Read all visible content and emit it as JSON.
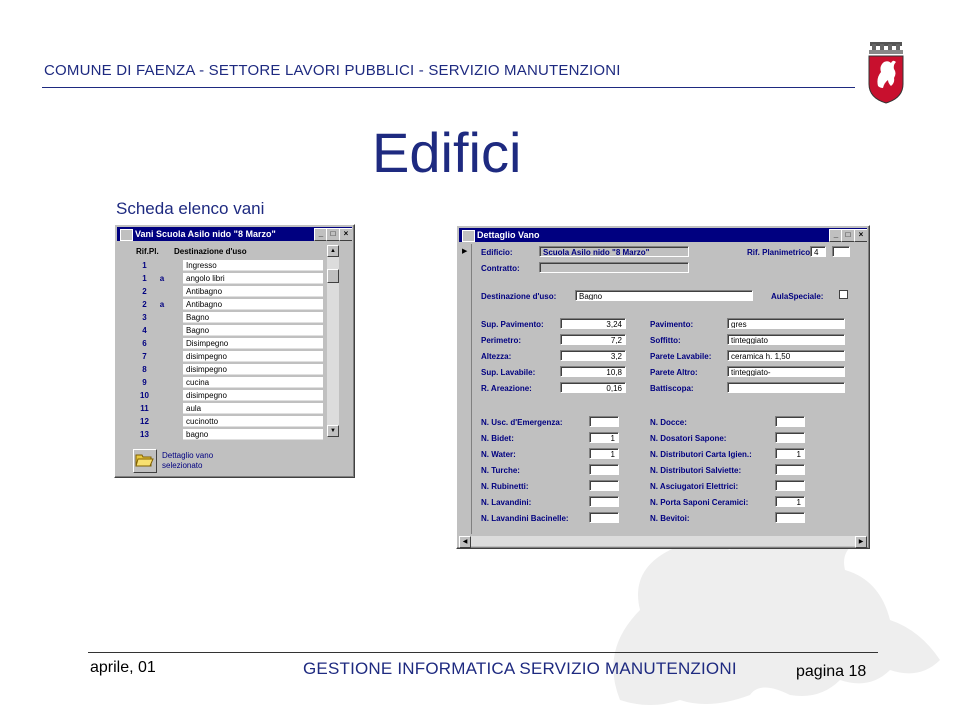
{
  "header": {
    "title": "COMUNE DI FAENZA - SETTORE LAVORI PUBBLICI - SERVIZIO MANUTENZIONI"
  },
  "slide": {
    "title": "Edifici",
    "subtitle": "Scheda elenco vani"
  },
  "list_window": {
    "title": "Vani Scuola Asilo nido \"8 Marzo\"",
    "col_rif": "Rif.Pl.",
    "col_dest": "Destinazione d'uso",
    "rows": [
      {
        "num": "1",
        "suf": "",
        "dest": "Ingresso"
      },
      {
        "num": "1",
        "suf": "a",
        "dest": "angolo libri"
      },
      {
        "num": "2",
        "suf": "",
        "dest": "Antibagno"
      },
      {
        "num": "2",
        "suf": "a",
        "dest": "Antibagno"
      },
      {
        "num": "3",
        "suf": "",
        "dest": "Bagno"
      },
      {
        "num": "4",
        "suf": "",
        "dest": "Bagno"
      },
      {
        "num": "6",
        "suf": "",
        "dest": "Disimpegno"
      },
      {
        "num": "7",
        "suf": "",
        "dest": "disimpegno"
      },
      {
        "num": "8",
        "suf": "",
        "dest": "disimpegno"
      },
      {
        "num": "9",
        "suf": "",
        "dest": "cucina"
      },
      {
        "num": "10",
        "suf": "",
        "dest": "disimpegno"
      },
      {
        "num": "11",
        "suf": "",
        "dest": "aula"
      },
      {
        "num": "12",
        "suf": "",
        "dest": "cucinotto"
      },
      {
        "num": "13",
        "suf": "",
        "dest": "bagno"
      }
    ],
    "detail_label": "Dettaglio vano selezionato"
  },
  "detail_window": {
    "title": "Dettaglio Vano",
    "edificio_label": "Edificio:",
    "edificio_value": "Scuola Asilo nido \"8 Marzo\"",
    "rif_label": "Rif. Planimetrico:",
    "rif_value": "4",
    "contratto_label": "Contratto:",
    "contratto_value": "",
    "destinazione_label": "Destinazione d'uso:",
    "destinazione_value": "Bagno",
    "aula_label": "AulaSpeciale:",
    "left_fields": [
      {
        "label": "Sup. Pavimento:",
        "value": "3,24"
      },
      {
        "label": "Perimetro:",
        "value": "7,2"
      },
      {
        "label": "Altezza:",
        "value": "3,2"
      },
      {
        "label": "Sup. Lavabile:",
        "value": "10,8"
      },
      {
        "label": "R. Areazione:",
        "value": "0,16"
      }
    ],
    "right_fields": [
      {
        "label": "Pavimento:",
        "value": "gres"
      },
      {
        "label": "Soffitto:",
        "value": "tinteggiato"
      },
      {
        "label": "Parete Lavabile:",
        "value": "ceramica h. 1,50"
      },
      {
        "label": "Parete Altro:",
        "value": "tinteggiato-"
      },
      {
        "label": "Battiscopa:",
        "value": ""
      }
    ],
    "left_counts": [
      {
        "label": "N. Usc. d'Emergenza:",
        "value": ""
      },
      {
        "label": "N. Bidet:",
        "value": "1"
      },
      {
        "label": "N. Water:",
        "value": "1"
      },
      {
        "label": "N. Turche:",
        "value": ""
      },
      {
        "label": "N. Rubinetti:",
        "value": ""
      },
      {
        "label": "N. Lavandini:",
        "value": ""
      },
      {
        "label": "N. Lavandini Bacinelle:",
        "value": ""
      }
    ],
    "right_counts": [
      {
        "label": "N. Docce:",
        "value": ""
      },
      {
        "label": "N. Dosatori Sapone:",
        "value": ""
      },
      {
        "label": "N. Distributori Carta Igien.:",
        "value": "1"
      },
      {
        "label": "N. Distributori Salviette:",
        "value": ""
      },
      {
        "label": "N. Asciugatori Elettrici:",
        "value": ""
      },
      {
        "label": "N. Porta Saponi Ceramici:",
        "value": "1"
      },
      {
        "label": "N. Bevitoi:",
        "value": ""
      }
    ]
  },
  "footer": {
    "date": "aprile, 01",
    "center": "GESTIONE INFORMATICA SERVIZIO MANUTENZIONI",
    "page": "pagina 18"
  },
  "colors": {
    "brand": "#1e2a80",
    "titlebar": "#000080",
    "window": "#c0c0c0"
  }
}
